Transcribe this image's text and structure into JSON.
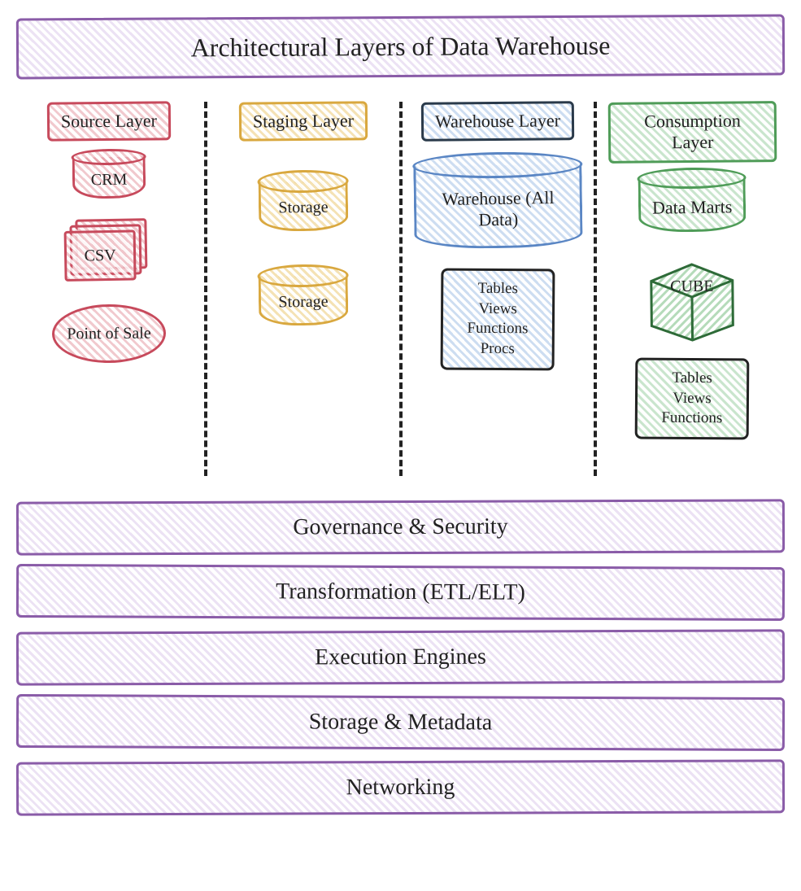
{
  "title": "Architectural Layers of Data Warehouse",
  "columns": {
    "source": {
      "header": "Source Layer",
      "items": [
        {
          "label": "CRM",
          "shape": "cylinder"
        },
        {
          "label": "CSV",
          "shape": "sheets"
        },
        {
          "label": "Point of Sale",
          "shape": "ellipse"
        }
      ]
    },
    "staging": {
      "header": "Staging Layer",
      "items": [
        {
          "label": "Storage",
          "shape": "cylinder"
        },
        {
          "label": "Storage",
          "shape": "cylinder"
        }
      ]
    },
    "warehouse": {
      "header": "Warehouse Layer",
      "items": [
        {
          "label": "Warehouse (All Data)",
          "shape": "cylinder"
        },
        {
          "label": "Tables\nViews\nFunctions\nProcs",
          "shape": "box"
        }
      ]
    },
    "consumption": {
      "header": "Consumption Layer",
      "items": [
        {
          "label": "Data Marts",
          "shape": "cylinder"
        },
        {
          "label": "CUBE",
          "shape": "cube"
        },
        {
          "label": "Tables\nViews\nFunctions",
          "shape": "box"
        }
      ]
    }
  },
  "foundation": [
    "Governance & Security",
    "Transformation (ETL/ELT)",
    "Execution Engines",
    "Storage & Metadata",
    "Networking"
  ],
  "colors": {
    "title": "#8a5ca8",
    "source": "#c74a5c",
    "staging": "#d9a83f",
    "warehouse": "#5a86c4",
    "consumption": "#4f9c58"
  }
}
